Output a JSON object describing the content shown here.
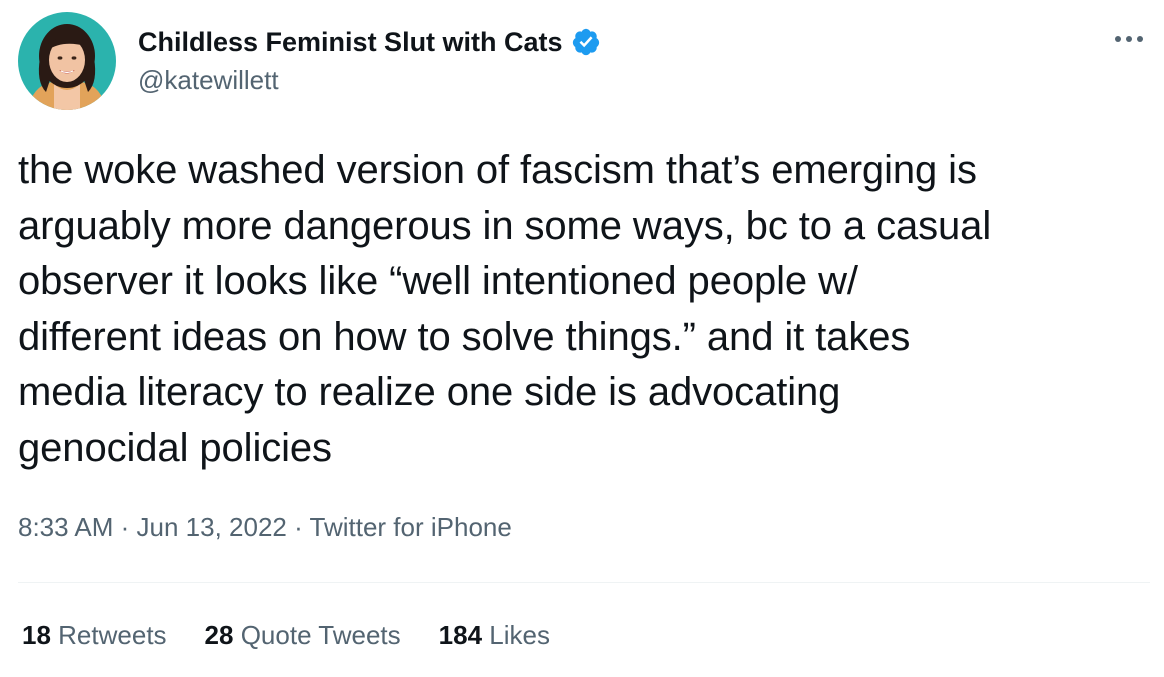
{
  "author": {
    "display_name": "Childless Feminist Slut with Cats",
    "handle": "@katewillett",
    "verified_icon": "verified-badge-icon"
  },
  "more_icon": "more-horizontal-icon",
  "tweet": {
    "lines": [
      "the woke washed version of fascism that’s emerging is",
      "arguably more dangerous in some ways, bc to a casual",
      "observer it looks like “well intentioned people w/",
      "different ideas on how to solve things.” and it takes",
      "media literacy to realize one side is advocating",
      "genocidal policies"
    ]
  },
  "meta": {
    "time": "8:33 AM",
    "date": "Jun 13, 2022",
    "source": "Twitter for iPhone",
    "separator": " · "
  },
  "stats": {
    "retweets_count": "18",
    "retweets_label": "Retweets",
    "quotes_count": "28",
    "quotes_label": "Quote Tweets",
    "likes_count": "184",
    "likes_label": "Likes"
  },
  "colors": {
    "accent": "#1d9bf0",
    "text": "#0f1419",
    "secondary": "#536471",
    "avatar_bg": "#2bb3ad"
  }
}
